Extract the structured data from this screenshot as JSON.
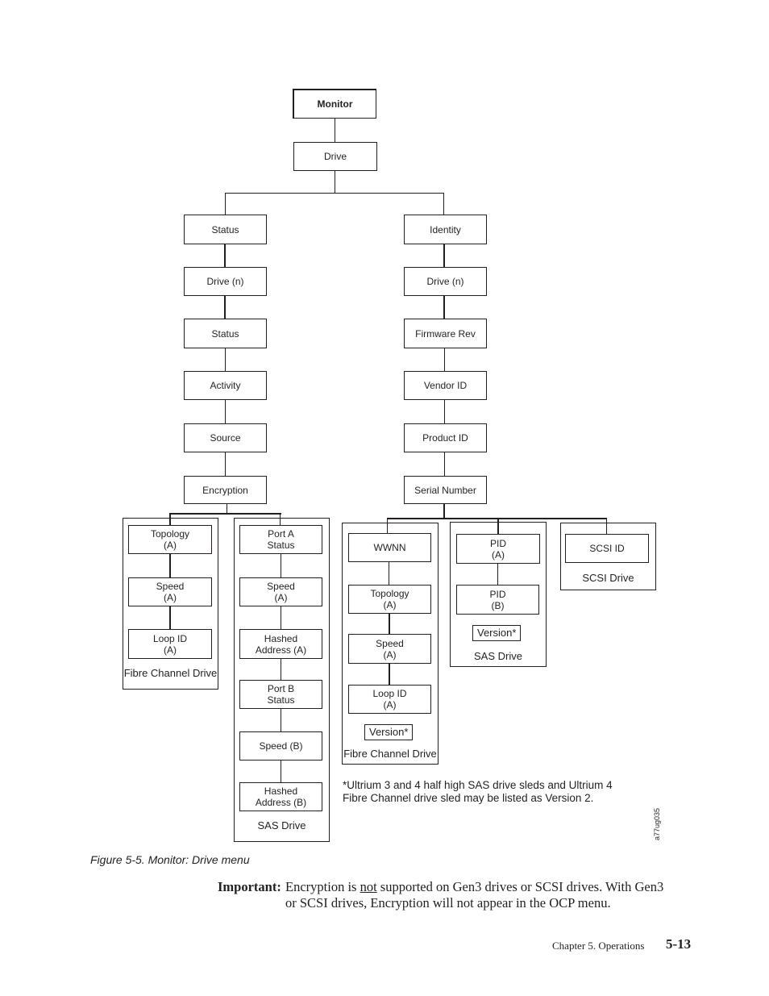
{
  "diagram": {
    "root": "Monitor",
    "level1": "Drive",
    "status_branch": [
      "Status",
      "Drive (n)",
      "Status",
      "Activity",
      "Source",
      "Encryption"
    ],
    "identity_branch": [
      "Identity",
      "Drive (n)",
      "Firmware Rev",
      "Vendor ID",
      "Product ID",
      "Serial Number"
    ],
    "status_groups": {
      "fibre_channel": {
        "label": "Fibre Channel Drive",
        "items": [
          "Topology\n(A)",
          "Speed\n(A)",
          "Loop ID\n(A)"
        ]
      },
      "sas": {
        "label": "SAS Drive",
        "items": [
          "Port A\nStatus",
          "Speed\n(A)",
          "Hashed\nAddress (A)",
          "Port B\nStatus",
          "Speed (B)",
          "Hashed\nAddress (B)"
        ]
      }
    },
    "identity_groups": {
      "fibre_channel": {
        "label": "Fibre Channel Drive",
        "items": [
          "WWNN",
          "Topology\n(A)",
          "Speed\n(A)",
          "Loop ID\n(A)"
        ],
        "version": "Version*"
      },
      "sas": {
        "label": "SAS Drive",
        "items": [
          "PID\n(A)",
          "PID\n(B)"
        ],
        "version": "Version*"
      },
      "scsi": {
        "label": "SCSI Drive",
        "items": [
          "SCSI ID"
        ]
      }
    },
    "footnote_line1": "*Ultrium 3 and 4 half high SAS drive sleds and Ultrium 4",
    "footnote_line2": "Fibre Channel drive sled may be listed as Version 2.",
    "figure_id": "a77ug035"
  },
  "caption": "Figure 5-5. Monitor: Drive menu",
  "important": {
    "label": "Important:",
    "line1_a": "Encryption is ",
    "line1_u": "not",
    "line1_b": " supported on Gen3 drives or SCSI drives. With Gen3",
    "line2": "or SCSI drives, Encryption will not appear in the OCP menu."
  },
  "footer": {
    "chapter": "Chapter 5. Operations",
    "page": "5-13"
  }
}
